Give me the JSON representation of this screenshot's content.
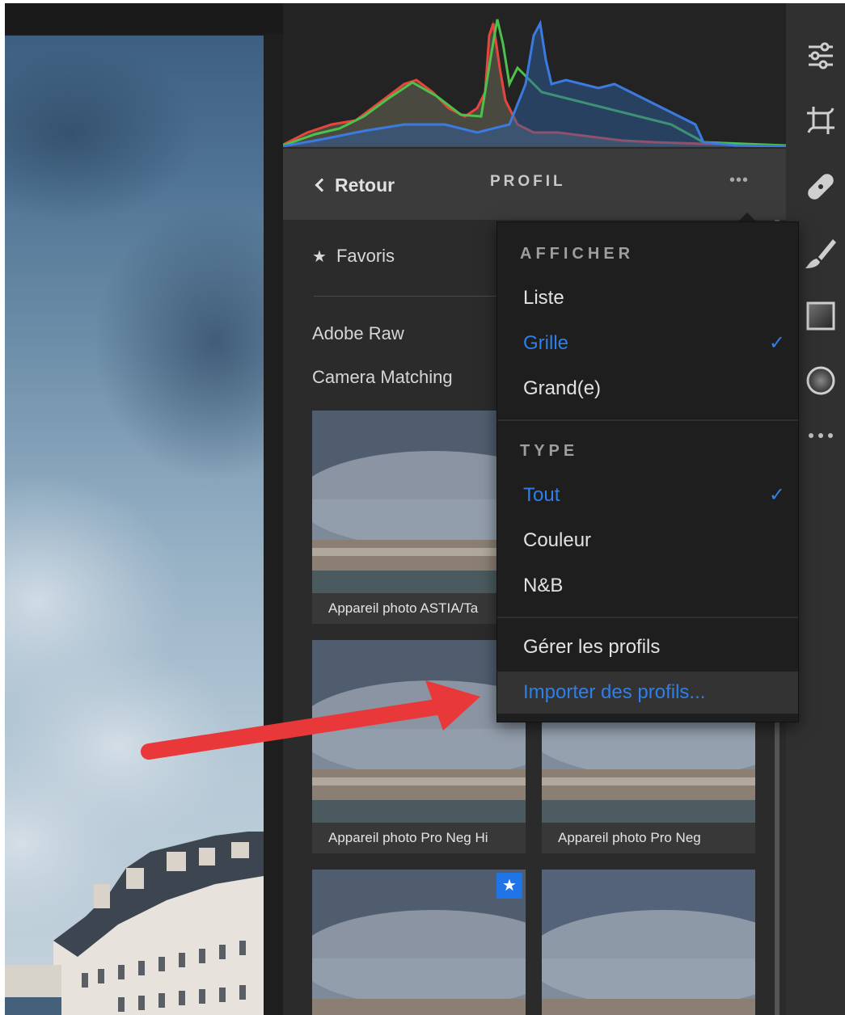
{
  "profile_panel": {
    "back_label": "Retour",
    "title": "PROFIL",
    "more_label": "•••"
  },
  "profile_list": {
    "favorites_label": "Favoris",
    "groups": [
      "Adobe Raw",
      "Camera Matching"
    ],
    "thumbnails": [
      {
        "caption": "Appareil photo ASTIA/Ta",
        "favorite": false
      },
      {
        "caption": "Appareil photo Pro Neg Hi",
        "favorite": false
      },
      {
        "caption": "Appareil photo Pro Neg",
        "favorite": false
      },
      {
        "caption": "",
        "favorite": true
      },
      {
        "caption": "",
        "favorite": false
      }
    ]
  },
  "menu": {
    "display_section": "AFFICHER",
    "display_items": [
      {
        "label": "Liste",
        "selected": false
      },
      {
        "label": "Grille",
        "selected": true
      },
      {
        "label": "Grand(e)",
        "selected": false
      }
    ],
    "type_section": "TYPE",
    "type_items": [
      {
        "label": "Tout",
        "selected": true
      },
      {
        "label": "Couleur",
        "selected": false
      },
      {
        "label": "N&B",
        "selected": false
      }
    ],
    "manage_label": "Gérer les profils",
    "import_label": "Importer des profils...",
    "checkmark": "✓"
  },
  "toolbar": {
    "tools": [
      "sliders-icon",
      "crop-icon",
      "healing-bandage-icon",
      "brush-icon",
      "gradient-icon",
      "radial-filter-icon",
      "more-icon"
    ]
  },
  "colors": {
    "accent": "#2e7fe8",
    "annotation_arrow": "#e8383a",
    "panel_bg": "#2b2b2b",
    "menu_bg": "#1e1e1e"
  }
}
